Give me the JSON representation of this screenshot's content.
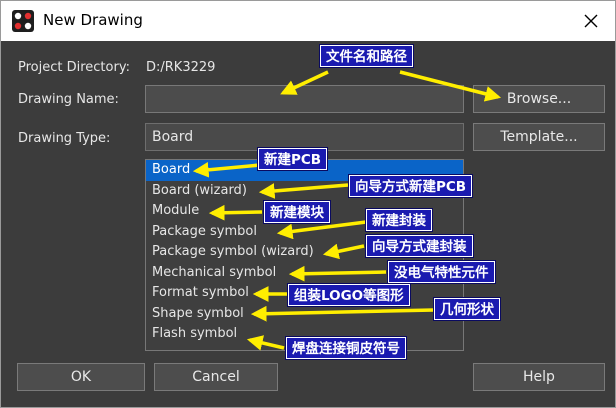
{
  "window": {
    "title": "New Drawing",
    "icon": "app-logo-icon",
    "close_icon": "close-icon"
  },
  "form": {
    "project_directory_label": "Project Directory:",
    "project_directory_value": "D:/RK3229",
    "drawing_name_label": "Drawing Name:",
    "drawing_name_value": "",
    "drawing_type_label": "Drawing Type:",
    "drawing_type_value": "Board",
    "browse_label": "Browse...",
    "template_label": "Template..."
  },
  "drawing_types": [
    "Board",
    "Board (wizard)",
    "Module",
    "Package symbol",
    "Package symbol (wizard)",
    "Mechanical symbol",
    "Format symbol",
    "Shape symbol",
    "Flash symbol"
  ],
  "selected_index": 0,
  "buttons": {
    "ok": "OK",
    "cancel": "Cancel",
    "help": "Help"
  },
  "annotations": {
    "file_path": "文件名和路径",
    "board": "新建PCB",
    "board_wizard": "向导方式新建PCB",
    "module": "新建模块",
    "package": "新建封装",
    "package_wizard": "向导方式建封装",
    "mechanical": "没电气特性元件",
    "format": "组装LOGO等图形",
    "shape": "几何形状",
    "flash": "焊盘连接铜皮符号"
  },
  "colors": {
    "dialog_bg": "#3c3c3c",
    "selection": "#0a64c8",
    "callout_bg": "#1a1ab0",
    "arrow": "#ffee00"
  }
}
